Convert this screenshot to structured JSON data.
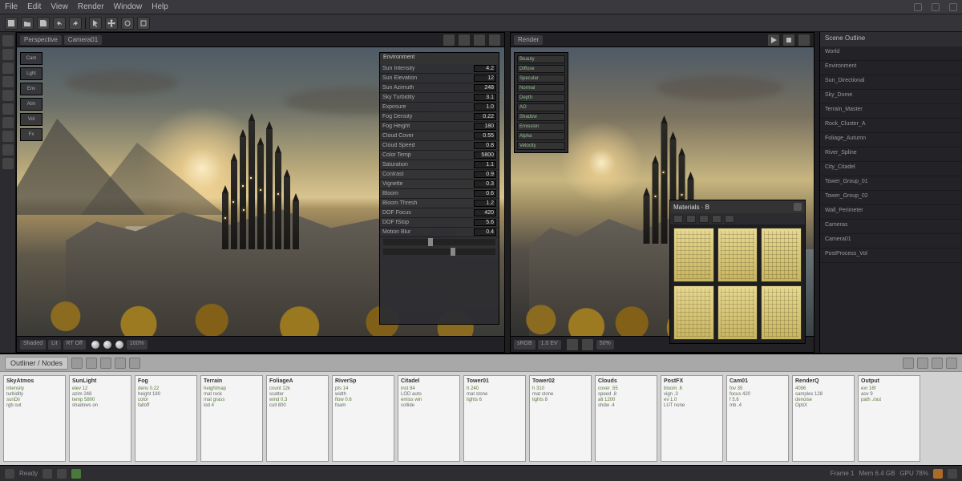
{
  "menu": {
    "items": [
      "File",
      "Edit",
      "View",
      "Render",
      "Window",
      "Help"
    ]
  },
  "toolbar_icons": [
    "new",
    "open",
    "save",
    "undo",
    "redo",
    "cut",
    "copy",
    "paste",
    "sep",
    "select",
    "move",
    "rotate",
    "scale"
  ],
  "left_viewport": {
    "tabs": [
      "Perspective",
      "Camera01"
    ],
    "status_chips": [
      "Shaded",
      "Lit",
      "RT Off",
      "100%"
    ],
    "quickstack": [
      "Cam",
      "Lght",
      "Env",
      "Atm",
      "Vol",
      "Fx"
    ]
  },
  "right_viewport": {
    "tabs": [
      "Render"
    ],
    "status_chips": [
      "sRGB",
      "1.0 EV",
      "50%"
    ],
    "channels": [
      "Beauty",
      "Diffuse",
      "Specular",
      "Normal",
      "Depth",
      "AO",
      "Shadow",
      "Emission",
      "Alpha",
      "Velocity"
    ]
  },
  "properties": {
    "title": "Environment",
    "rows": [
      {
        "l": "Sun Intensity",
        "v": "4.2"
      },
      {
        "l": "Sun Elevation",
        "v": "12"
      },
      {
        "l": "Sun Azimuth",
        "v": "248"
      },
      {
        "l": "Sky Turbidity",
        "v": "3.1"
      },
      {
        "l": "Exposure",
        "v": "1.0"
      },
      {
        "l": "Fog Density",
        "v": "0.22"
      },
      {
        "l": "Fog Height",
        "v": "180"
      },
      {
        "l": "Cloud Cover",
        "v": "0.55"
      },
      {
        "l": "Cloud Speed",
        "v": "0.8"
      },
      {
        "l": "Color Temp",
        "v": "5800"
      },
      {
        "l": "Saturation",
        "v": "1.1"
      },
      {
        "l": "Contrast",
        "v": "0.9"
      },
      {
        "l": "Vignette",
        "v": "0.3"
      },
      {
        "l": "Bloom",
        "v": "0.6"
      },
      {
        "l": "Bloom Thresh",
        "v": "1.2"
      },
      {
        "l": "DOF Focus",
        "v": "420"
      },
      {
        "l": "DOF fStop",
        "v": "5.6"
      },
      {
        "l": "Motion Blur",
        "v": "0.4"
      }
    ]
  },
  "swatches": {
    "title": "Materials · B"
  },
  "inspector": {
    "title": "Scene Outline",
    "items": [
      "World",
      "  Environment",
      "  Sun_Directional",
      "  Sky_Dome",
      "  Terrain_Master",
      "    Rock_Cluster_A",
      "    Foliage_Autumn",
      "    River_Spline",
      "  City_Citadel",
      "    Tower_Group_01",
      "    Tower_Group_02",
      "    Wall_Perimeter",
      "  Cameras",
      "    Camera01",
      "  PostProcess_Vol"
    ]
  },
  "bottom": {
    "title": "Outliner / Nodes",
    "icons": 10,
    "right_icons": 8,
    "nodes": [
      {
        "t": "SkyAtmos",
        "lines": [
          "intensity",
          "turbidity",
          "sunDir",
          "rgb out"
        ]
      },
      {
        "t": "SunLight",
        "lines": [
          "elev 12",
          "azim 248",
          "temp 5800",
          "shadows on"
        ]
      },
      {
        "t": "Fog",
        "lines": [
          "dens 0.22",
          "height 180",
          "color",
          "falloff"
        ]
      },
      {
        "t": "Terrain",
        "lines": [
          "heightmap",
          "mat rock",
          "mat grass",
          "lod 4"
        ]
      },
      {
        "t": "FoliageA",
        "lines": [
          "count 12k",
          "scatter",
          "wind 0.3",
          "cull 800"
        ]
      },
      {
        "t": "RiverSp",
        "lines": [
          "pts 14",
          "width",
          "flow 0.6",
          "foam"
        ]
      },
      {
        "t": "Citadel",
        "lines": [
          "inst 84",
          "LOD auto",
          "emiss win",
          "collide"
        ]
      },
      {
        "t": "Tower01",
        "lines": [
          "h 240",
          "mat stone",
          "lights 6",
          ""
        ]
      },
      {
        "t": "Tower02",
        "lines": [
          "h 310",
          "mat stone",
          "lights 8",
          ""
        ]
      },
      {
        "t": "Clouds",
        "lines": [
          "cover .55",
          "speed .8",
          "alt 1200",
          "shdw .4"
        ]
      },
      {
        "t": "PostFX",
        "lines": [
          "bloom .6",
          "vign .3",
          "ev 1.0",
          "LUT none"
        ]
      },
      {
        "t": "Cam01",
        "lines": [
          "fov 35",
          "focus 420",
          "f 5.6",
          "mb .4"
        ]
      },
      {
        "t": "RenderQ",
        "lines": [
          "4096",
          "samples 128",
          "denoise",
          "OptiX"
        ]
      },
      {
        "t": "Output",
        "lines": [
          "exr 16f",
          "aov 9",
          "path ./out",
          ""
        ]
      }
    ]
  },
  "statusbar": {
    "left": "Ready",
    "frame": "Frame 1",
    "mem": "Mem 6.4 GB",
    "gpu": "GPU 78%"
  },
  "colors": {
    "accent": "#d8c490",
    "panel": "#2c2c30"
  }
}
